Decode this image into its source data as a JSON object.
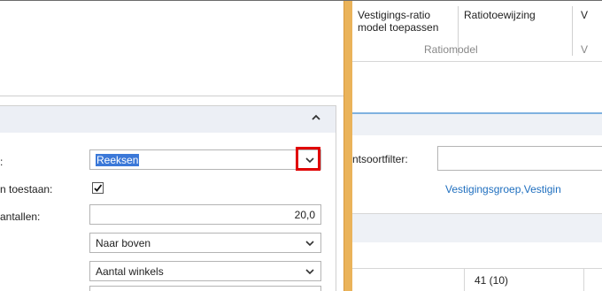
{
  "ribbon": {
    "btn1_line1": "Vestigings-ratio",
    "btn1_line2": "model toepassen",
    "btn2_label": "Ratiotoewijzing",
    "btn3_partial": "V",
    "group_label": "Ratiomodel",
    "group2_partial": "V"
  },
  "left": {
    "row1_label": ":",
    "row1_value": "Reeksen",
    "row2_label": "n toestaan:",
    "row2_checked": "✔",
    "row3_label": "antallen:",
    "row3_value": "20,0",
    "row4_value": "Naar boven",
    "row5_value": "Aantal winkels"
  },
  "right": {
    "filter_label": "ntsoortfilter:",
    "filter_link": "Vestigingsgroep,Vestigin",
    "table_cell": "41 (10)"
  },
  "icons": {
    "collapse": "chevron-up-icon",
    "dropdown": "chevron-down-icon",
    "checkbox": "checkmark-icon"
  },
  "colors": {
    "selection": "#3b78d8",
    "highlight": "#e00000",
    "divider": "#eab35a",
    "link": "#1f6fbf"
  }
}
